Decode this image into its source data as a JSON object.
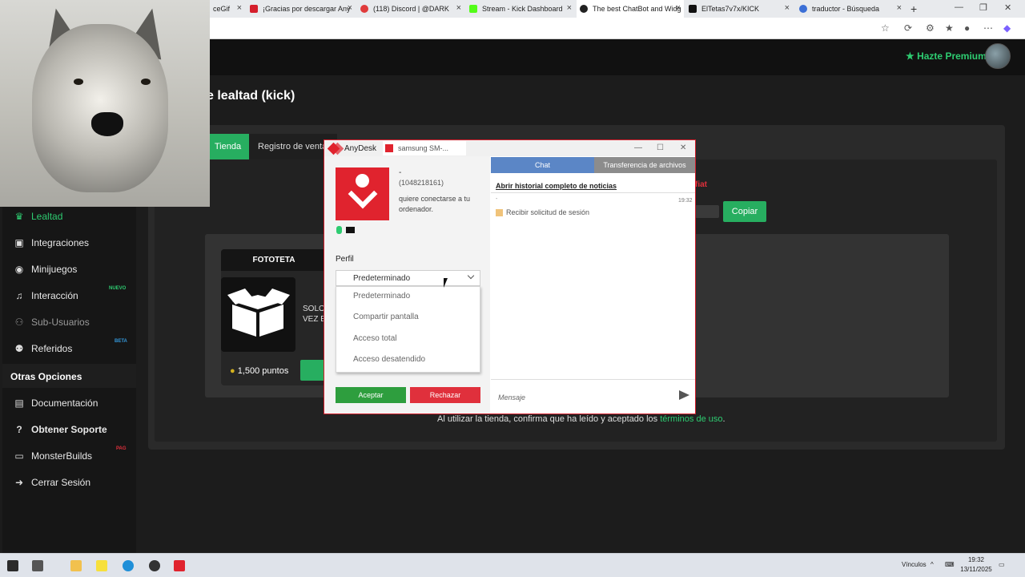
{
  "browser": {
    "tabs": [
      {
        "label": "ceGif",
        "color": "#999999"
      },
      {
        "label": "¡Gracias por descargar Any",
        "color": "#d51f2c"
      },
      {
        "label": "(118) Discord | @DARK",
        "color": "#e03b3b"
      },
      {
        "label": "Stream - Kick Dashboard",
        "color": "#53fc18"
      },
      {
        "label": "The best ChatBot and Widg",
        "color": "#222222"
      },
      {
        "label": "ElTetas7v7x/KICK",
        "color": "#111111"
      },
      {
        "label": "traductor - Búsqueda",
        "color": "#3b6fd6"
      }
    ],
    "new_tab": "+"
  },
  "header": {
    "premium_label": "Hazte Premium",
    "premium_icon": "star-icon"
  },
  "page": {
    "title": "e lealtad (kick)",
    "tabs": {
      "store": "Tienda",
      "sales": "Registro de venta"
    },
    "copy_button": "Copiar",
    "red_fragment": "fiat"
  },
  "sidebar": {
    "items": [
      {
        "label": "Lealtad",
        "icon": "trophy-icon"
      },
      {
        "label": "Integraciones",
        "icon": "integration-icon"
      },
      {
        "label": "Minijuegos",
        "icon": "gamepad-icon",
        "badge": ""
      },
      {
        "label": "Interacción",
        "icon": "music-icon",
        "badge": "NUEVO"
      },
      {
        "label": "Sub-Usuarios",
        "icon": "users-icon"
      },
      {
        "label": "Referidos",
        "icon": "referral-icon",
        "badge": "BETA"
      }
    ],
    "section_title": "Otras Opciones",
    "other_items": [
      {
        "label": "Documentación",
        "icon": "book-icon"
      },
      {
        "label": "Obtener Soporte",
        "icon": "help-icon"
      },
      {
        "label": "MonsterBuilds",
        "icon": "monitor-icon",
        "badge": "PAG"
      },
      {
        "label": "Cerrar Sesión",
        "icon": "logout-icon"
      }
    ]
  },
  "store": {
    "card": {
      "title": "FOTOTETA",
      "text_line1": "SOLO",
      "text_line2": "VEZ E",
      "points": "1,500 puntos"
    },
    "footer_text": "Al utilizar la tienda, confirma que ha leído y aceptado los ",
    "footer_link": "términos de uso",
    "footer_end": "."
  },
  "anydesk": {
    "app_name": "AnyDesk",
    "session_tab": "samsung SM-...",
    "remote_dash": "-",
    "remote_id": "(1048218161)",
    "request_text": "quiere conectarse a tu ordenador.",
    "profile_label": "Perfil",
    "profile_selected": "Predeterminado",
    "profile_options": [
      "Predeterminado",
      "Compartir pantalla",
      "Acceso total",
      "Acceso desatendido"
    ],
    "accept_label": "Aceptar",
    "reject_label": "Rechazar",
    "chat_tab": "Chat",
    "files_tab": "Transferencia de archivos",
    "history_link": "Abrir historial completo de noticias",
    "event_dash": "-",
    "event_time": "19:32",
    "event_text": "Recibir solicitud de sesión",
    "message_placeholder": "Mensaje"
  },
  "taskbar": {
    "links_label": "Vínculos",
    "time": "19:32",
    "date": "13/11/2025"
  },
  "colors": {
    "accent_green": "#27ae60",
    "anydesk_red": "#e0232e",
    "chat_blue": "#5b86c6"
  }
}
